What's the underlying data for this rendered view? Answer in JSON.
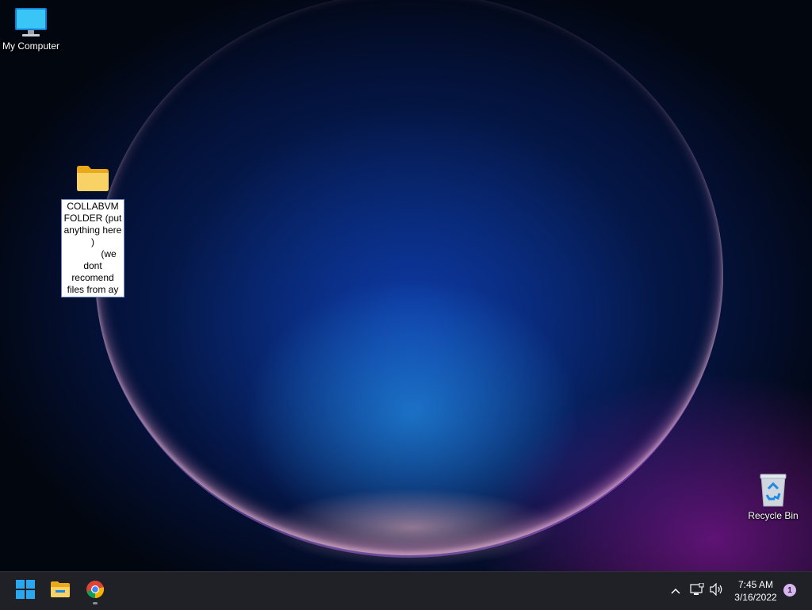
{
  "desktop": {
    "icons": [
      {
        "label": "My Computer",
        "icon": "monitor-icon"
      },
      {
        "label": "COLLABVM FOLDER (put anything here )\n            (we dont recomend files from ay",
        "icon": "folder-icon"
      },
      {
        "label": "Recycle Bin",
        "icon": "recycle-bin-icon"
      }
    ]
  },
  "taskbar": {
    "pinned": [
      {
        "name": "Start",
        "icon": "windows-logo-icon"
      },
      {
        "name": "File Explorer",
        "icon": "folder-icon"
      },
      {
        "name": "Google Chrome",
        "icon": "chrome-icon",
        "running": true
      }
    ],
    "tray": {
      "time": "7:45 AM",
      "date": "3/16/2022",
      "notification_count": "1"
    }
  },
  "colors": {
    "taskbar_bg": "#1f2127",
    "start_blue": "#29a8f0",
    "folder_yellow": "#f6c844",
    "badge_lilac": "#d8b4f0"
  }
}
